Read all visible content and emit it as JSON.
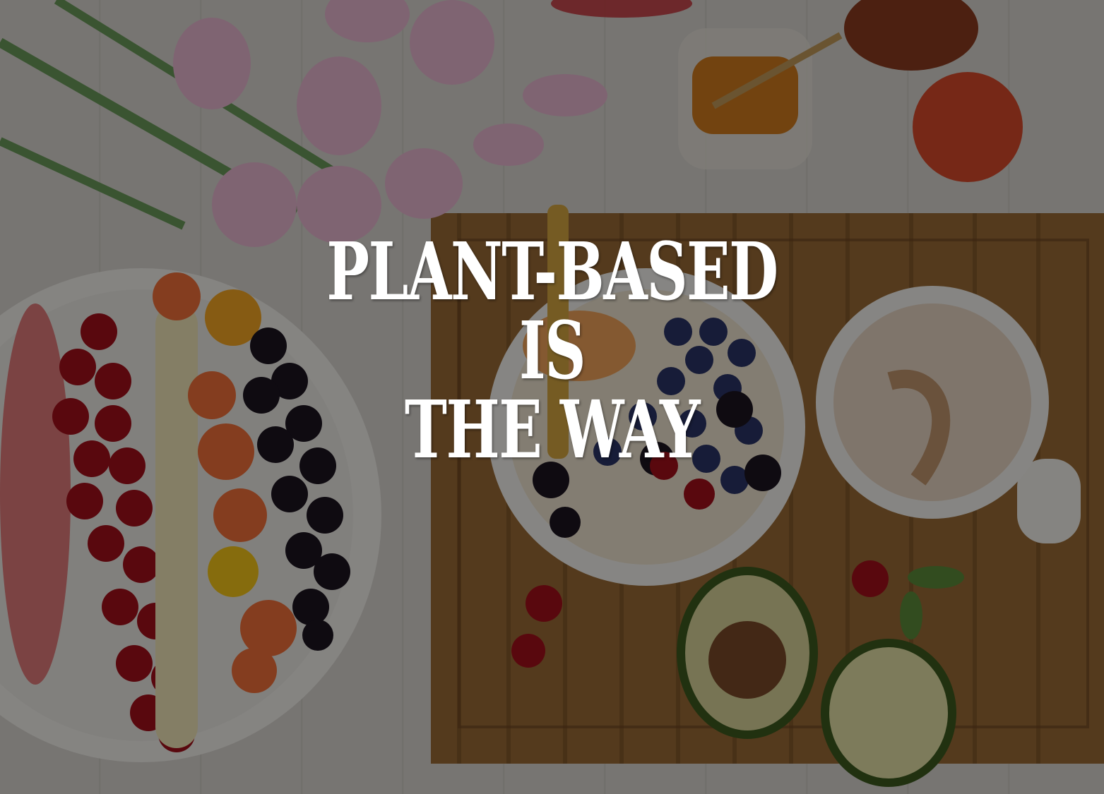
{
  "headline": {
    "line1": "PLANT-BASED",
    "line2": "IS",
    "line3": "THE WAY"
  },
  "colors": {
    "text": "#ffffff",
    "board": "#9a6a35",
    "table": "#d9d6d0"
  },
  "icons": {
    "fruit-platter": "plate with cherries, blackberries, radish, tomato, corn",
    "smoothie-bowl": "bowl with blueberries and blackberries",
    "coffee-cup": "cup of latte",
    "avocado": "halved avocado",
    "honey-jar": "jar of honey with dipper",
    "tulips": "pink tulips bouquet"
  }
}
